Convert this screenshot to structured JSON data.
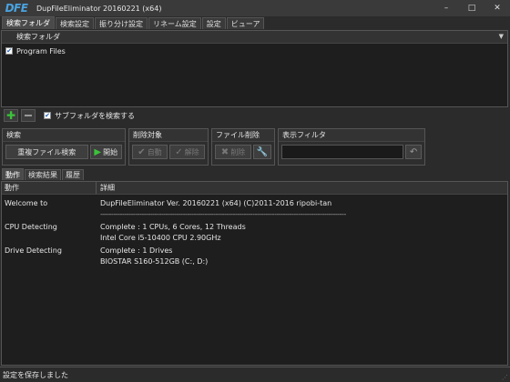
{
  "window": {
    "logo": "DFE",
    "title": "DupFileEliminator 20160221 (x64)",
    "btn_min": "–",
    "btn_max": "□",
    "btn_close": "✕"
  },
  "tabs": [
    "検索フォルダ",
    "検索設定",
    "振り分け設定",
    "リネーム設定",
    "設定",
    "ビューア"
  ],
  "folders": {
    "header": "検索フォルダ",
    "items": [
      {
        "label": "Program Files",
        "checked": true
      }
    ]
  },
  "folder_toolbar": {
    "add_icon": "plus-icon",
    "remove_icon": "minus-icon",
    "subfolder_label": "サブフォルダを検索する",
    "subfolder_checked": true
  },
  "groups": {
    "search": {
      "title": "検索",
      "dup_label": "重複ファイル検索",
      "start_label": "開始"
    },
    "delete_target": {
      "title": "削除対象",
      "auto_label": "自動",
      "release_label": "解除"
    },
    "file_delete": {
      "title": "ファイル削除",
      "delete_label": "削除"
    },
    "display_filter": {
      "title": "表示フィルタ",
      "value": ""
    }
  },
  "lower_tabs": [
    "動作",
    "検索結果",
    "履歴"
  ],
  "log": {
    "col_action": "動作",
    "col_detail": "詳細",
    "rows": [
      {
        "action": "Welcome to",
        "detail": "DupFileEliminator Ver. 20160221 (x64) (C)2011-2016 ripobi-tan"
      },
      {
        "action": "",
        "detail": "-----------------------------------------------------------------------------------------------------------------"
      },
      {
        "action": "CPU Detecting",
        "detail": "Complete : 1 CPUs, 6 Cores, 12 Threads"
      },
      {
        "action": "",
        "detail": "Intel Core i5-10400 CPU 2.90GHz"
      },
      {
        "action": "Drive Detecting",
        "detail": "Complete : 1 Drives"
      },
      {
        "action": "",
        "detail": "BIOSTAR S160-512GB (C:, D:)"
      }
    ]
  },
  "status": "設定を保存しました",
  "colors": {
    "accent_green": "#3cc23c",
    "logo_blue": "#4aa3e0",
    "bg": "#2b2b2b"
  }
}
